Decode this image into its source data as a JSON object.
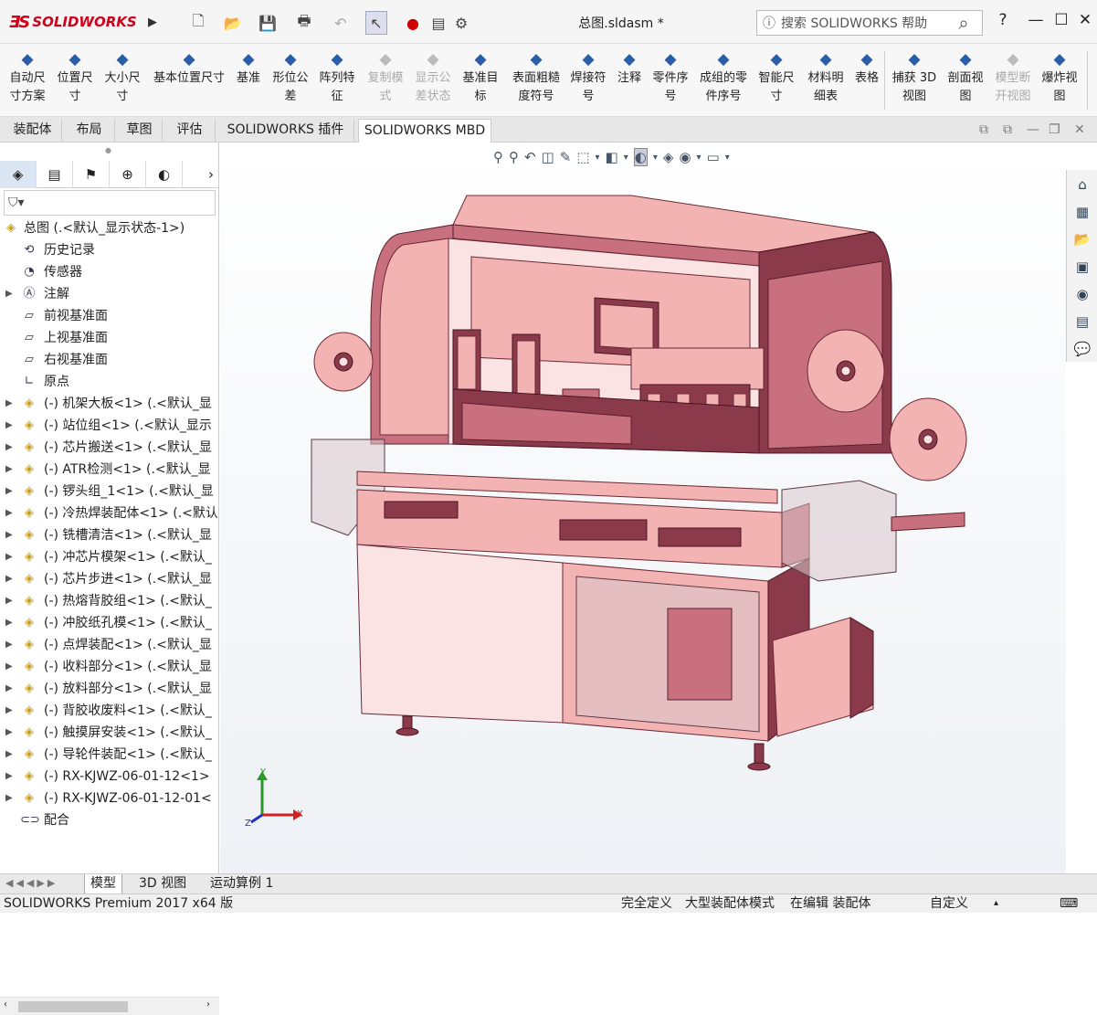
{
  "app": {
    "logo": "SOLIDWORKS",
    "document_title": "总图.sldasm *"
  },
  "quick_access": {
    "icons": [
      "new-icon",
      "open-icon",
      "save-icon",
      "print-icon",
      "undo-icon",
      "select-icon",
      "rebuild-icon",
      "file-properties-icon",
      "options-icon"
    ]
  },
  "help_search": {
    "placeholder": "搜索 SOLIDWORKS 帮助"
  },
  "window_controls": {
    "help": "?",
    "minimize": "—",
    "maximize": "☐",
    "close": "✕"
  },
  "toolbar": {
    "items": [
      {
        "label1": "自动尺",
        "label2": "寸方案",
        "icon": "auto-dimension-icon",
        "enabled": true
      },
      {
        "label1": "位置尺",
        "label2": "寸",
        "icon": "location-dimension-icon",
        "enabled": true
      },
      {
        "label1": "大小尺",
        "label2": "寸",
        "icon": "size-dimension-icon",
        "enabled": true
      },
      {
        "label1": "基本位置尺寸",
        "label2": "",
        "icon": "basic-location-dimension-icon",
        "enabled": true
      },
      {
        "label1": "基准",
        "label2": "",
        "icon": "datum-icon",
        "enabled": true
      },
      {
        "label1": "形位公",
        "label2": "差",
        "icon": "geometric-tolerance-icon",
        "enabled": true
      },
      {
        "label1": "阵列特",
        "label2": "征",
        "icon": "pattern-feature-icon",
        "enabled": true
      },
      {
        "label1": "复制模",
        "label2": "式",
        "icon": "copy-scheme-icon",
        "enabled": false
      },
      {
        "label1": "显示公",
        "label2": "差状态",
        "icon": "show-tolerance-status-icon",
        "enabled": false
      },
      {
        "label1": "基准目",
        "label2": "标",
        "icon": "datum-target-icon",
        "enabled": true
      },
      {
        "label1": "表面粗糙",
        "label2": "度符号",
        "icon": "surface-finish-icon",
        "enabled": true
      },
      {
        "label1": "焊接符",
        "label2": "号",
        "icon": "weld-symbol-icon",
        "enabled": true
      },
      {
        "label1": "注释",
        "label2": "",
        "icon": "note-icon",
        "enabled": true
      },
      {
        "label1": "零件序",
        "label2": "号",
        "icon": "balloon-icon",
        "enabled": true
      },
      {
        "label1": "成组的零",
        "label2": "件序号",
        "icon": "stacked-balloon-icon",
        "enabled": true
      },
      {
        "label1": "智能尺",
        "label2": "寸",
        "icon": "smart-dimension-icon",
        "enabled": true
      },
      {
        "label1": "材料明",
        "label2": "细表",
        "icon": "bom-icon",
        "enabled": true
      },
      {
        "label1": "表格",
        "label2": "",
        "icon": "table-icon",
        "enabled": true
      },
      {
        "label1": "捕获 3D",
        "label2": "视图",
        "icon": "capture-3d-view-icon",
        "enabled": true
      },
      {
        "label1": "剖面视",
        "label2": "图",
        "icon": "section-view-icon",
        "enabled": true
      },
      {
        "label1": "模型断",
        "label2": "开视图",
        "icon": "model-break-view-icon",
        "enabled": false
      },
      {
        "label1": "爆炸视",
        "label2": "图",
        "icon": "exploded-view-icon",
        "enabled": true
      }
    ]
  },
  "tabs": [
    "装配体",
    "布局",
    "草图",
    "评估",
    "SOLIDWORKS 插件",
    "SOLIDWORKS MBD"
  ],
  "active_tab": "SOLIDWORKS MBD",
  "feature_tree": {
    "root": "总图  (.<默认_显示状态-1>)",
    "filter_icon": "filter-icon",
    "items": [
      {
        "label": "历史记录",
        "icon": "history-icon",
        "expand": false
      },
      {
        "label": "传感器",
        "icon": "sensor-icon",
        "expand": false
      },
      {
        "label": "注解",
        "icon": "annotation-icon",
        "expand": true
      },
      {
        "label": "前视基准面",
        "icon": "plane-icon",
        "expand": false
      },
      {
        "label": "上视基准面",
        "icon": "plane-icon",
        "expand": false
      },
      {
        "label": "右视基准面",
        "icon": "plane-icon",
        "expand": false
      },
      {
        "label": "原点",
        "icon": "origin-icon",
        "expand": false
      },
      {
        "label": "(-) 机架大板<1> (.<默认_显",
        "icon": "component-icon",
        "expand": true
      },
      {
        "label": "(-) 站位组<1> (.<默认_显示",
        "icon": "component-icon",
        "expand": true
      },
      {
        "label": "(-) 芯片搬送<1> (.<默认_显",
        "icon": "component-icon",
        "expand": true
      },
      {
        "label": "(-) ATR检测<1> (.<默认_显",
        "icon": "component-icon",
        "expand": true
      },
      {
        "label": "(-) 锣头组_1<1> (.<默认_显",
        "icon": "component-icon",
        "expand": true
      },
      {
        "label": "(-) 冷热焊装配体<1> (.<默认",
        "icon": "component-icon",
        "expand": true
      },
      {
        "label": "(-) 铣槽清洁<1> (.<默认_显",
        "icon": "component-icon",
        "expand": true
      },
      {
        "label": "(-) 冲芯片模架<1> (.<默认_",
        "icon": "component-icon",
        "expand": true
      },
      {
        "label": "(-) 芯片步进<1> (.<默认_显",
        "icon": "component-icon",
        "expand": true
      },
      {
        "label": "(-) 热熔背胶组<1> (.<默认_",
        "icon": "component-icon",
        "expand": true
      },
      {
        "label": "(-) 冲胶纸孔模<1> (.<默认_",
        "icon": "component-icon",
        "expand": true
      },
      {
        "label": "(-) 点焊装配<1> (.<默认_显",
        "icon": "component-icon",
        "expand": true
      },
      {
        "label": "(-) 收料部分<1> (.<默认_显",
        "icon": "component-icon",
        "expand": true
      },
      {
        "label": "(-) 放料部分<1> (.<默认_显",
        "icon": "component-icon",
        "expand": true
      },
      {
        "label": "(-) 背胶收废料<1> (.<默认_",
        "icon": "component-icon",
        "expand": true
      },
      {
        "label": "(-) 触摸屏安装<1> (.<默认_",
        "icon": "component-icon",
        "expand": true
      },
      {
        "label": "(-) 导轮件装配<1> (.<默认_",
        "icon": "component-icon",
        "expand": true
      },
      {
        "label": "(-) RX-KJWZ-06-01-12<1>",
        "icon": "component-icon",
        "expand": true
      },
      {
        "label": "(-) RX-KJWZ-06-01-12-01<",
        "icon": "component-icon",
        "expand": true
      },
      {
        "label": "配合",
        "icon": "mates-icon",
        "expand": false
      }
    ]
  },
  "bottom_tabs": [
    "模型",
    "3D 视图",
    "运动算例 1"
  ],
  "active_bottom_tab": "模型",
  "status": {
    "product": "SOLIDWORKS Premium 2017 x64 版",
    "definition": "完全定义",
    "mode": "大型装配体模式",
    "editing": "在编辑 装配体",
    "units": "自定义"
  },
  "triad": {
    "x": "X",
    "y": "Y",
    "z": "Z"
  },
  "colors": {
    "model_fill": "#f4b3b3",
    "model_dark": "#8a3a4a",
    "accent": "#d0021b"
  }
}
